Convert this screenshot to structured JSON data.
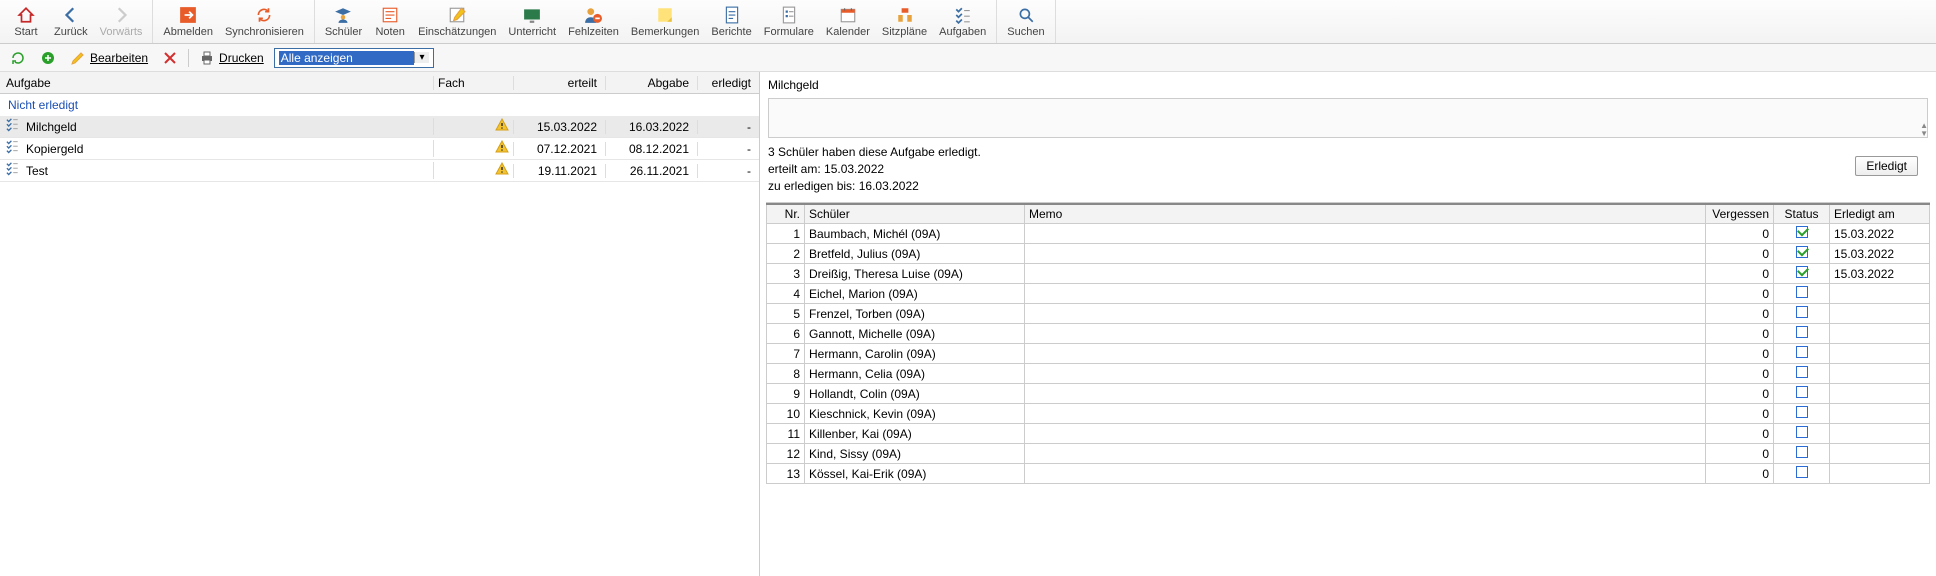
{
  "toolbar": {
    "start": "Start",
    "back": "Zurück",
    "forward": "Vorwärts",
    "logout": "Abmelden",
    "sync": "Synchronisieren",
    "students": "Schüler",
    "grades": "Noten",
    "assessments": "Einschätzungen",
    "lessons": "Unterricht",
    "absences": "Fehlzeiten",
    "notes": "Bemerkungen",
    "reports": "Berichte",
    "forms": "Formulare",
    "calendar": "Kalender",
    "seating": "Sitzpläne",
    "tasks": "Aufgaben",
    "search": "Suchen"
  },
  "toolbar2": {
    "edit": "Bearbeiten",
    "print": "Drucken",
    "filter_selected": "Alle anzeigen"
  },
  "task_table": {
    "headers": {
      "task": "Aufgabe",
      "subject": "Fach",
      "assigned": "erteilt",
      "due": "Abgabe",
      "done": "erledigt"
    },
    "group": "Nicht erledigt",
    "rows": [
      {
        "name": "Milchgeld",
        "fach": "",
        "erteilt": "15.03.2022",
        "abgabe": "16.03.2022",
        "erledigt": "-",
        "selected": true
      },
      {
        "name": "Kopiergeld",
        "fach": "",
        "erteilt": "07.12.2021",
        "abgabe": "08.12.2021",
        "erledigt": "-",
        "selected": false
      },
      {
        "name": "Test",
        "fach": "",
        "erteilt": "19.11.2021",
        "abgabe": "26.11.2021",
        "erledigt": "-",
        "selected": false
      }
    ]
  },
  "detail": {
    "title": "Milchgeld",
    "line1": "3 Schüler haben diese Aufgabe erledigt.",
    "line2a": "erteilt am: ",
    "line2b": "15.03.2022",
    "line3a": "zu erledigen bis: ",
    "line3b": "16.03.2022",
    "done_btn": "Erledigt"
  },
  "students": {
    "headers": {
      "nr": "Nr.",
      "name": "Schüler",
      "memo": "Memo",
      "verg": "Vergessen",
      "status": "Status",
      "am": "Erledigt am"
    },
    "rows": [
      {
        "nr": 1,
        "name": "Baumbach, Michél (09A)",
        "verg": 0,
        "status": true,
        "am": "15.03.2022"
      },
      {
        "nr": 2,
        "name": "Bretfeld, Julius (09A)",
        "verg": 0,
        "status": true,
        "am": "15.03.2022"
      },
      {
        "nr": 3,
        "name": "Dreißig, Theresa Luise (09A)",
        "verg": 0,
        "status": true,
        "am": "15.03.2022"
      },
      {
        "nr": 4,
        "name": "Eichel, Marion (09A)",
        "verg": 0,
        "status": false,
        "am": ""
      },
      {
        "nr": 5,
        "name": "Frenzel, Torben (09A)",
        "verg": 0,
        "status": false,
        "am": ""
      },
      {
        "nr": 6,
        "name": "Gannott, Michelle (09A)",
        "verg": 0,
        "status": false,
        "am": ""
      },
      {
        "nr": 7,
        "name": "Hermann, Carolin (09A)",
        "verg": 0,
        "status": false,
        "am": ""
      },
      {
        "nr": 8,
        "name": "Hermann, Celia (09A)",
        "verg": 0,
        "status": false,
        "am": ""
      },
      {
        "nr": 9,
        "name": "Hollandt, Colin (09A)",
        "verg": 0,
        "status": false,
        "am": ""
      },
      {
        "nr": 10,
        "name": "Kieschnick, Kevin (09A)",
        "verg": 0,
        "status": false,
        "am": ""
      },
      {
        "nr": 11,
        "name": "Killenber, Kai (09A)",
        "verg": 0,
        "status": false,
        "am": ""
      },
      {
        "nr": 12,
        "name": "Kind, Sissy (09A)",
        "verg": 0,
        "status": false,
        "am": ""
      },
      {
        "nr": 13,
        "name": "Kössel, Kai-Erik (09A)",
        "verg": 0,
        "status": false,
        "am": ""
      }
    ]
  }
}
